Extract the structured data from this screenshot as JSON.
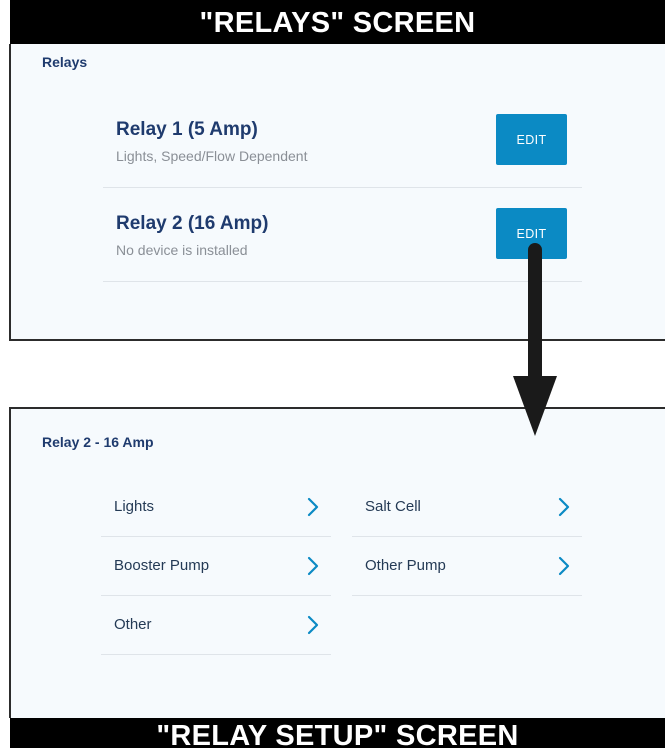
{
  "banners": {
    "top": "\"RELAYS\" SCREEN",
    "bottom": "\"RELAY SETUP\" SCREEN"
  },
  "relays_screen": {
    "title": "Relays",
    "items": [
      {
        "name": "Relay 1 (5 Amp)",
        "description": "Lights, Speed/Flow Dependent",
        "button": "EDIT"
      },
      {
        "name": "Relay 2 (16 Amp)",
        "description": "No device is installed",
        "button": "EDIT"
      }
    ]
  },
  "relay_setup_screen": {
    "title": "Relay 2 - 16 Amp",
    "options": [
      {
        "label": "Lights",
        "icon": "chevron-right-icon"
      },
      {
        "label": "Salt Cell",
        "icon": "chevron-right-icon"
      },
      {
        "label": "Booster Pump",
        "icon": "chevron-right-icon"
      },
      {
        "label": "Other Pump",
        "icon": "chevron-right-icon"
      },
      {
        "label": "Other",
        "icon": "chevron-right-icon"
      }
    ]
  },
  "colors": {
    "accent": "#0b8ac4",
    "title": "#1f3b6e",
    "panel_bg": "#f6fafd"
  }
}
